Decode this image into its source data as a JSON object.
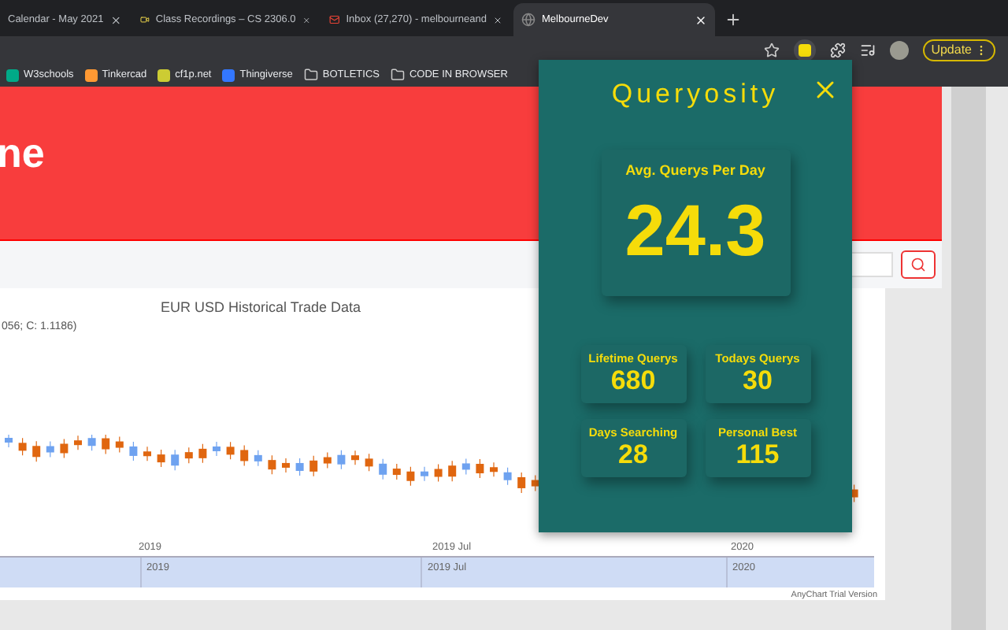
{
  "browser": {
    "tabs": [
      {
        "title": "Calendar - May 2021",
        "selected": false
      },
      {
        "title": "Class Recordings – CS 2306.0",
        "selected": false
      },
      {
        "title": "Inbox (27,270) - melbourneand",
        "selected": false
      },
      {
        "title": "MelbourneDev",
        "selected": true
      }
    ],
    "update_button": "Update",
    "bookmarks": [
      {
        "label": "W3schools",
        "kind": "site"
      },
      {
        "label": "Tinkercad",
        "kind": "site"
      },
      {
        "label": "cf1p.net",
        "kind": "site"
      },
      {
        "label": "Thingiverse",
        "kind": "site"
      },
      {
        "label": "BOTLETICS",
        "kind": "folder"
      },
      {
        "label": "CODE IN BROWSER",
        "kind": "folder"
      }
    ]
  },
  "page": {
    "header_title": "ne",
    "chart": {
      "title": "EUR USD Historical Trade Data",
      "legend": "056; C: 1.1186)",
      "x_labels": [
        "2019",
        "2019 Jul",
        "2020"
      ],
      "navigator_labels": [
        "2019",
        "2019 Jul",
        "2020"
      ],
      "credit": "AnyChart Trial Version"
    }
  },
  "popup": {
    "title": "Queryosity",
    "main_stat": {
      "label": "Avg. Querys Per Day",
      "value": "24.3"
    },
    "stats": [
      {
        "label": "Lifetime Querys",
        "value": "680"
      },
      {
        "label": "Todays Querys",
        "value": "30"
      },
      {
        "label": "Days Searching",
        "value": "28"
      },
      {
        "label": "Personal Best",
        "value": "115"
      }
    ]
  }
}
